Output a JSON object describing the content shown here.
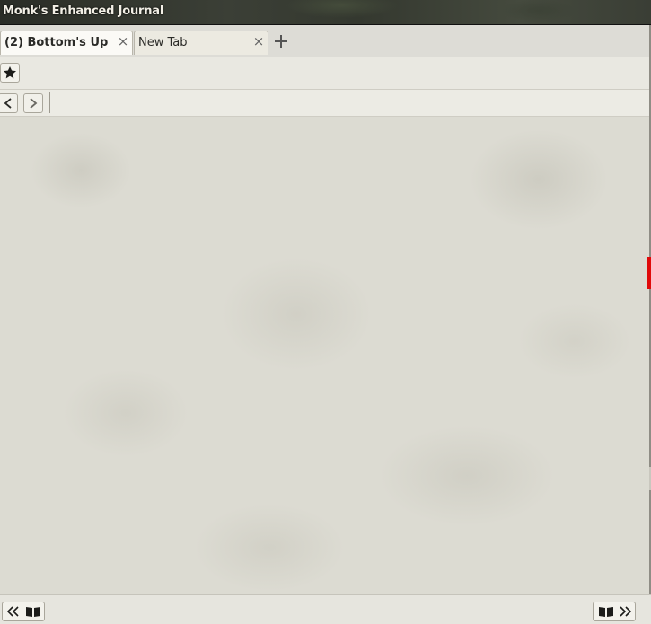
{
  "window": {
    "title": "Monk's Enhanced Journal"
  },
  "tabs": [
    {
      "label": "(2) Bottom's Up",
      "active": true,
      "close_icon": "close-icon"
    },
    {
      "label": "New Tab",
      "active": false,
      "close_icon": "close-icon"
    }
  ],
  "tab_bar": {
    "add_icon": "plus-icon",
    "close_glyph": "×"
  },
  "bookmark_bar": {
    "icon": "star-icon"
  },
  "nav_bar": {
    "back_icon": "chevron-left-icon",
    "forward_icon": "chevron-right-icon"
  },
  "footer": {
    "prev_icons": [
      "double-chevron-left-icon",
      "book-open-icon"
    ],
    "next_icons": [
      "book-open-icon",
      "double-chevron-right-icon"
    ]
  },
  "colors": {
    "accent_marker": "#e00a0a",
    "parchment": "#dcdbd2",
    "active_tab": "#fbfaf6"
  }
}
